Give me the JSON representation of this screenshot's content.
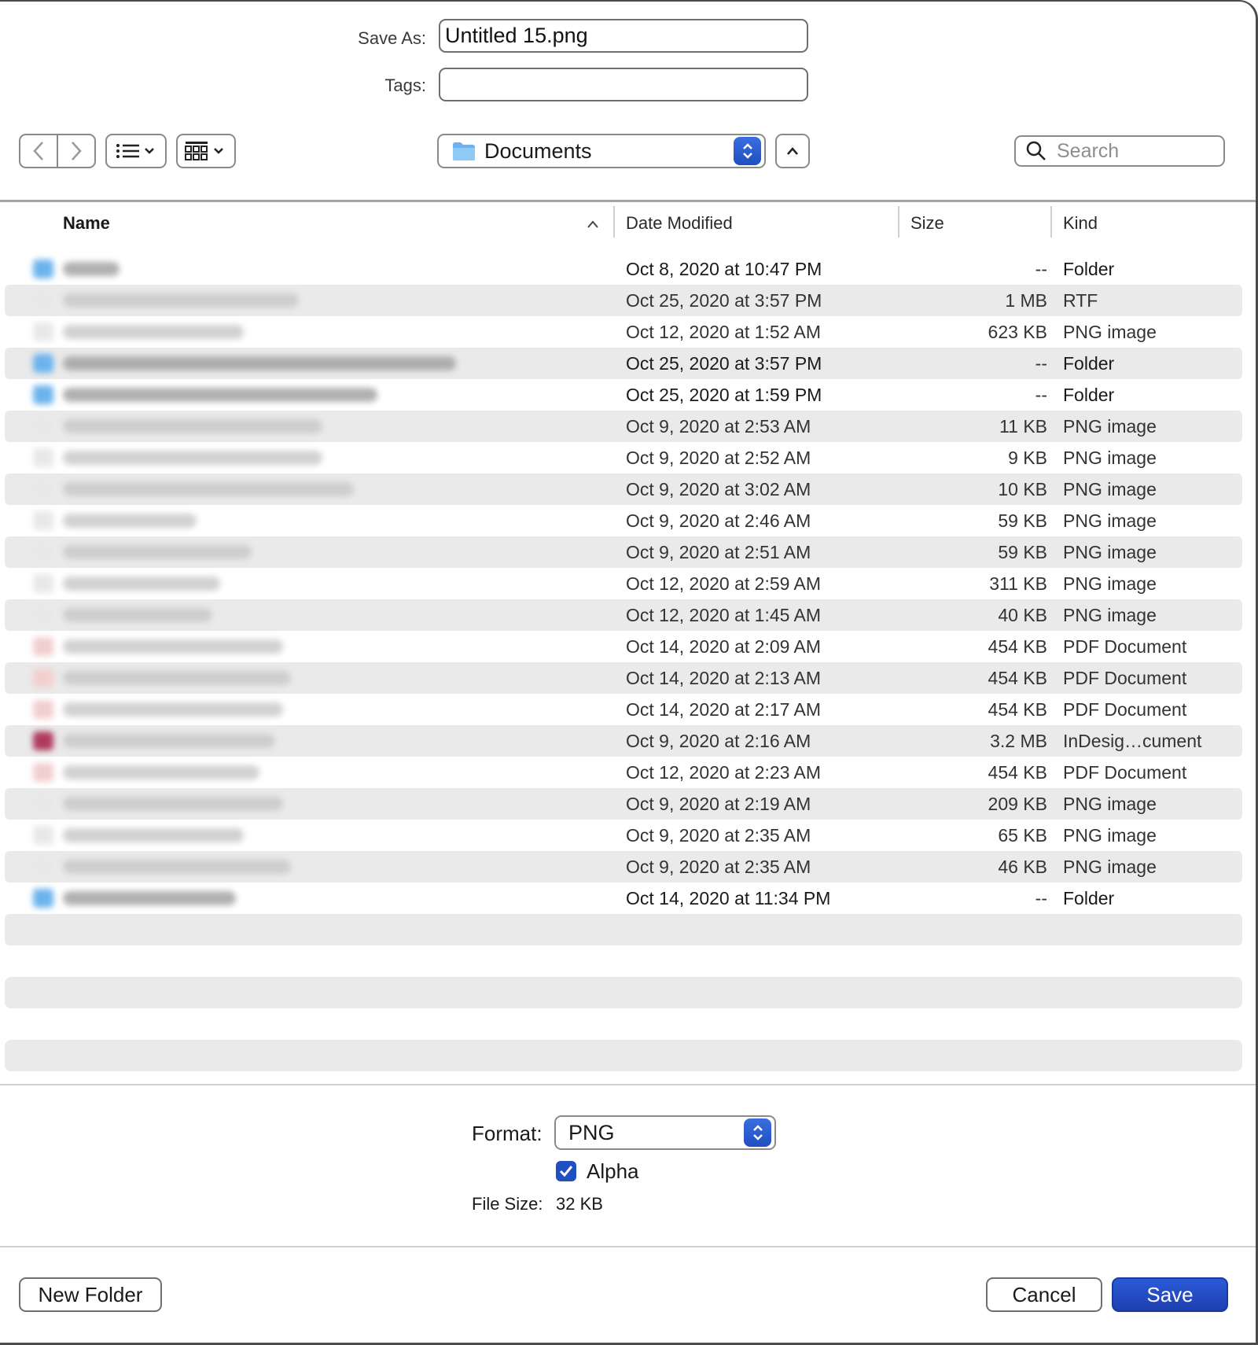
{
  "save_as": {
    "label": "Save As:",
    "value": "Untitled 15.png"
  },
  "tags": {
    "label": "Tags:",
    "value": ""
  },
  "toolbar": {
    "back_icon": "chevron-left-icon",
    "forward_icon": "chevron-right-icon",
    "list_view_icon": "list-icon",
    "group_view_icon": "grid-icon",
    "location": "Documents",
    "location_icon": "folder-icon",
    "search_placeholder": "Search"
  },
  "columns": {
    "name": "Name",
    "date": "Date Modified",
    "size": "Size",
    "kind": "Kind"
  },
  "files": [
    {
      "date": "Oct 8, 2020 at 10:47 PM",
      "size": "--",
      "kind": "Folder",
      "type": "folder"
    },
    {
      "date": "Oct 25, 2020 at 3:57 PM",
      "size": "1 MB",
      "kind": "RTF",
      "type": "file"
    },
    {
      "date": "Oct 12, 2020 at 1:52 AM",
      "size": "623 KB",
      "kind": "PNG image",
      "type": "file"
    },
    {
      "date": "Oct 25, 2020 at 3:57 PM",
      "size": "--",
      "kind": "Folder",
      "type": "folder"
    },
    {
      "date": "Oct 25, 2020 at 1:59 PM",
      "size": "--",
      "kind": "Folder",
      "type": "folder"
    },
    {
      "date": "Oct 9, 2020 at 2:53 AM",
      "size": "11 KB",
      "kind": "PNG image",
      "type": "file"
    },
    {
      "date": "Oct 9, 2020 at 2:52 AM",
      "size": "9 KB",
      "kind": "PNG image",
      "type": "file"
    },
    {
      "date": "Oct 9, 2020 at 3:02 AM",
      "size": "10 KB",
      "kind": "PNG image",
      "type": "file"
    },
    {
      "date": "Oct 9, 2020 at 2:46 AM",
      "size": "59 KB",
      "kind": "PNG image",
      "type": "file"
    },
    {
      "date": "Oct 9, 2020 at 2:51 AM",
      "size": "59 KB",
      "kind": "PNG image",
      "type": "file"
    },
    {
      "date": "Oct 12, 2020 at 2:59 AM",
      "size": "311 KB",
      "kind": "PNG image",
      "type": "file"
    },
    {
      "date": "Oct 12, 2020 at 1:45 AM",
      "size": "40 KB",
      "kind": "PNG image",
      "type": "file"
    },
    {
      "date": "Oct 14, 2020 at 2:09 AM",
      "size": "454 KB",
      "kind": "PDF Document",
      "type": "pdf"
    },
    {
      "date": "Oct 14, 2020 at 2:13 AM",
      "size": "454 KB",
      "kind": "PDF Document",
      "type": "pdf"
    },
    {
      "date": "Oct 14, 2020 at 2:17 AM",
      "size": "454 KB",
      "kind": "PDF Document",
      "type": "pdf"
    },
    {
      "date": "Oct 9, 2020 at 2:16 AM",
      "size": "3.2 MB",
      "kind": "InDesig…cument",
      "type": "indd"
    },
    {
      "date": "Oct 12, 2020 at 2:23 AM",
      "size": "454 KB",
      "kind": "PDF Document",
      "type": "pdf"
    },
    {
      "date": "Oct 9, 2020 at 2:19 AM",
      "size": "209 KB",
      "kind": "PNG image",
      "type": "file"
    },
    {
      "date": "Oct 9, 2020 at 2:35 AM",
      "size": "65 KB",
      "kind": "PNG image",
      "type": "file"
    },
    {
      "date": "Oct 9, 2020 at 2:35 AM",
      "size": "46 KB",
      "kind": "PNG image",
      "type": "file"
    },
    {
      "date": "Oct 14, 2020 at 11:34 PM",
      "size": "--",
      "kind": "Folder",
      "type": "folder"
    }
  ],
  "format": {
    "label": "Format:",
    "value": "PNG"
  },
  "alpha": {
    "label": "Alpha",
    "checked": true
  },
  "file_size": {
    "label": "File Size:",
    "value": "32 KB"
  },
  "buttons": {
    "new_folder": "New Folder",
    "cancel": "Cancel",
    "save": "Save"
  },
  "colors": {
    "accent": "#1f4fc0",
    "stripe": "#eaeaea",
    "folder": "#6cb3ee"
  }
}
